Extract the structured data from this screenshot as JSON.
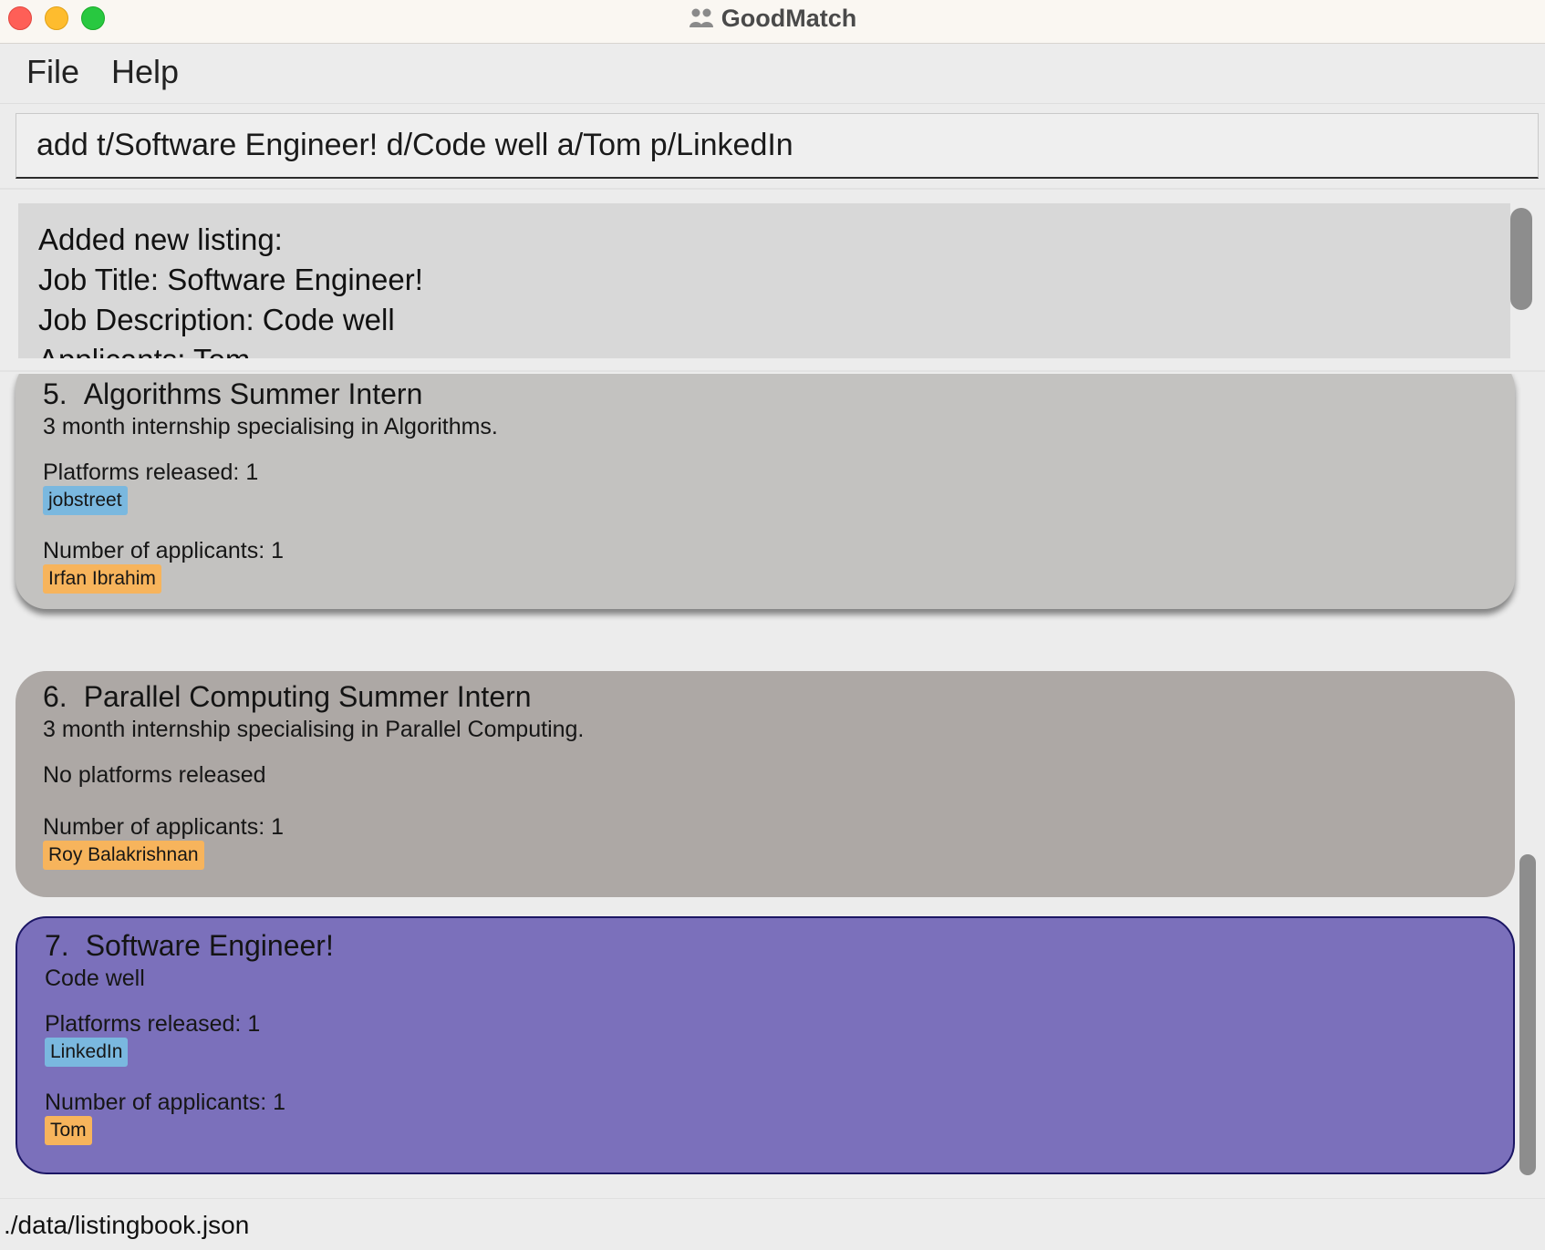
{
  "window": {
    "title": "GoodMatch",
    "icon": "people-icon"
  },
  "menu": {
    "file": "File",
    "help": "Help"
  },
  "command": {
    "value": "add t/Software Engineer! d/Code well a/Tom p/LinkedIn"
  },
  "result": {
    "lines": [
      "Added new listing:",
      "Job Title: Software Engineer!",
      "Job Description: Code well",
      "Applicants: Tom"
    ]
  },
  "listings": [
    {
      "index": "5.",
      "title": "Algorithms Summer Intern",
      "description": "3 month internship specialising in Algorithms.",
      "platforms_label": "Platforms released: 1",
      "platforms": [
        "jobstreet"
      ],
      "applicants_label": "Number of applicants: 1",
      "applicants": [
        "Irfan Ibrahim"
      ]
    },
    {
      "index": "6.",
      "title": "Parallel Computing Summer Intern",
      "description": "3 month internship specialising in Parallel Computing.",
      "platforms_label": "No platforms released",
      "platforms": [],
      "applicants_label": "Number of applicants: 1",
      "applicants": [
        "Roy Balakrishnan"
      ]
    },
    {
      "index": "7.",
      "title": "Software Engineer!",
      "description": "Code well",
      "platforms_label": "Platforms released: 1",
      "platforms": [
        "LinkedIn"
      ],
      "applicants_label": "Number of applicants: 1",
      "applicants": [
        "Tom"
      ],
      "selected": true
    }
  ],
  "status": {
    "path": "./data/listingbook.json"
  },
  "colors": {
    "selected_card": "#7b70bb",
    "platform_tag": "#7ab8df",
    "applicant_tag": "#f7b45c"
  }
}
